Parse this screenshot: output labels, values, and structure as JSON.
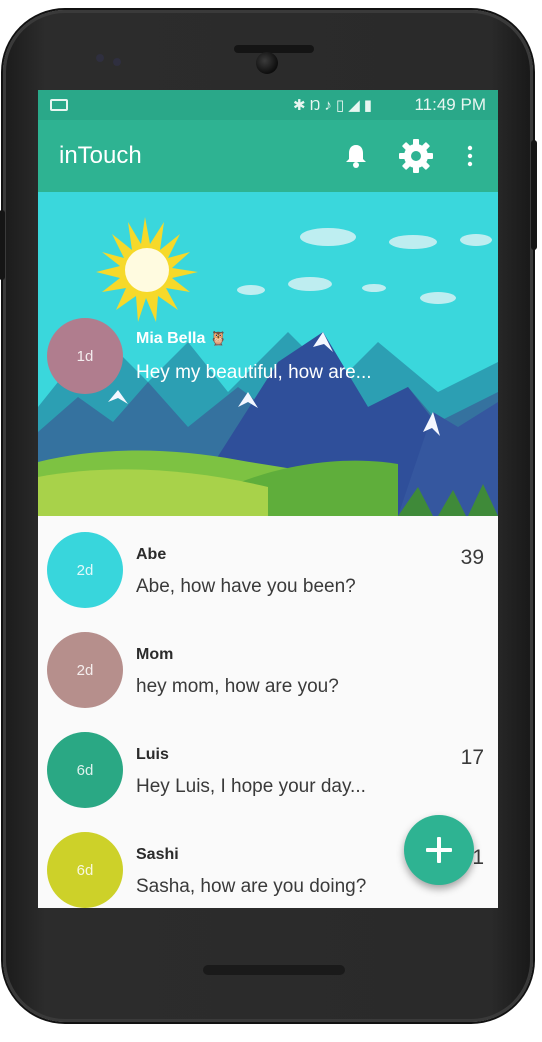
{
  "status_bar": {
    "time": "11:49 PM",
    "icons": [
      "bluetooth-icon",
      "nfc-icon",
      "mute-icon",
      "vibrate-icon",
      "signal-icon",
      "battery-icon"
    ]
  },
  "app_bar": {
    "title": "inTouch",
    "actions": [
      "bell-icon",
      "gear-icon",
      "overflow-menu-icon"
    ]
  },
  "featured": {
    "name": "Mia Bella",
    "emoji": "🦉",
    "message": "Hey my beautiful, how are...",
    "age": "1d",
    "avatar_color": "#b07d8e"
  },
  "conversations": [
    {
      "name": "Abe",
      "message": "Abe, how have you been?",
      "age": "2d",
      "count": "39",
      "avatar_color": "#38d6dc"
    },
    {
      "name": "Mom",
      "message": "hey mom, how are you?",
      "age": "2d",
      "count": "",
      "avatar_color": "#b68f8c"
    },
    {
      "name": "Luis",
      "message": "Hey Luis, I hope your day...",
      "age": "6d",
      "count": "17",
      "avatar_color": "#2aa884"
    },
    {
      "name": "Sashi",
      "message": "Sasha, how are you doing?",
      "age": "6d",
      "count": "1",
      "avatar_color": "#cdd129"
    }
  ],
  "colors": {
    "accent": "#2eb392",
    "status_bar": "#2aa889",
    "hero_sky": "#3ad7dc"
  },
  "fab_icon": "plus-icon"
}
